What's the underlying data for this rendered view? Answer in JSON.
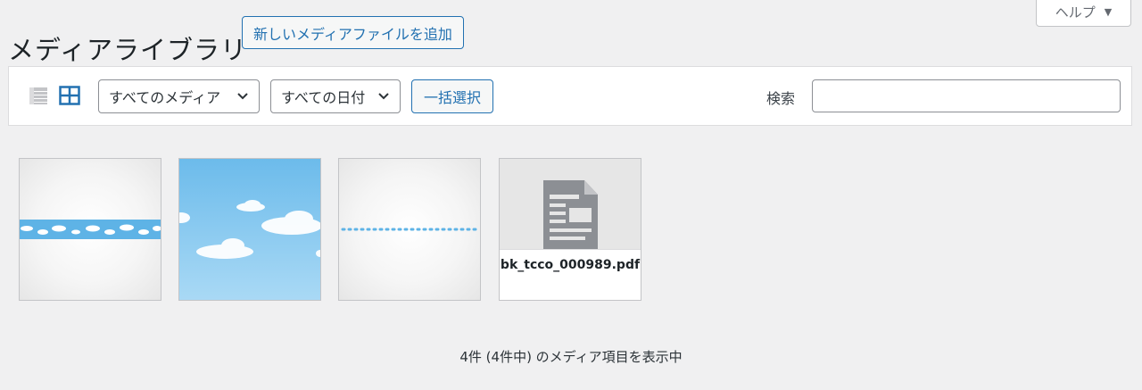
{
  "page": {
    "title": "メディアライブラリ",
    "add_new_label": "新しいメディアファイルを追加",
    "help_label": "ヘルプ"
  },
  "toolbar": {
    "type_filter": "すべてのメディア",
    "date_filter": "すべての日付",
    "bulk_select_label": "一括選択",
    "search_label": "検索",
    "search_value": ""
  },
  "media": [
    {
      "kind": "image",
      "description": "blue band with clouds"
    },
    {
      "kind": "image",
      "description": "sky with clouds"
    },
    {
      "kind": "image",
      "description": "dotted blue line"
    },
    {
      "kind": "document",
      "filename": "bk_tcco_000989.pdf"
    }
  ],
  "footer": {
    "count_text": "4件 (4件中) のメディア項目を表示中"
  },
  "colors": {
    "accent": "#2271b1",
    "background": "#f0f0f1",
    "sky": "#6cbbeb"
  },
  "icons": {
    "view_list": "list-view-icon",
    "view_grid": "grid-view-icon",
    "document": "document-icon"
  }
}
